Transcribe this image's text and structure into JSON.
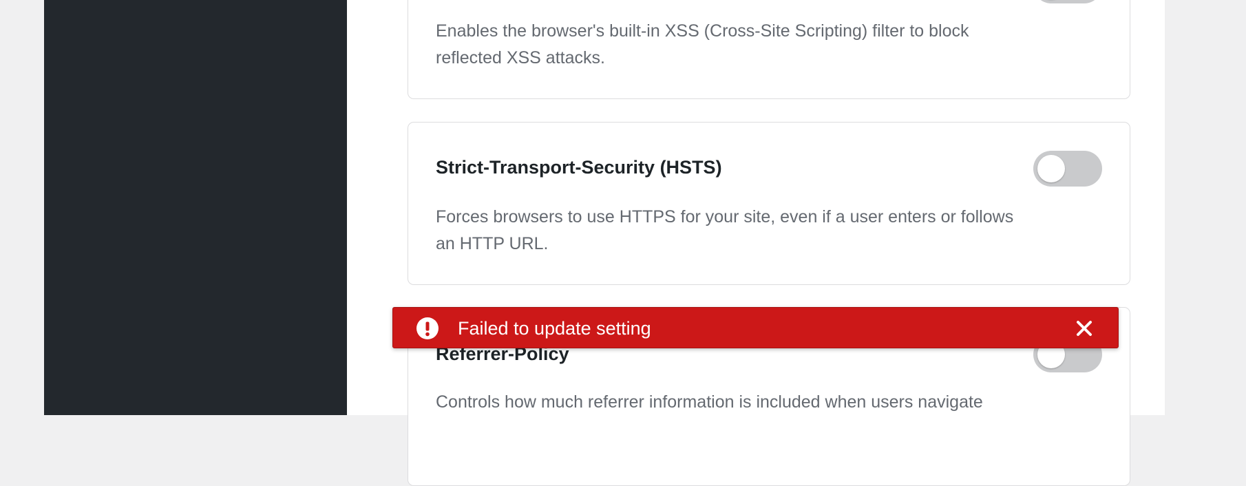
{
  "settings": [
    {
      "title": "",
      "description": "Enables the browser's built-in XSS (Cross-Site Scripting) filter to block reflected XSS attacks.",
      "enabled": false
    },
    {
      "title": "Strict-Transport-Security (HSTS)",
      "description": "Forces browsers to use HTTPS for your site, even if a user enters or follows an HTTP URL.",
      "enabled": false
    },
    {
      "title": "Referrer-Policy",
      "description": "Controls how much referrer information is included when users navigate",
      "enabled": false
    }
  ],
  "notice": {
    "message": "Failed to update setting",
    "type": "error",
    "icon": "exclamation-circle-icon",
    "close_icon": "close-icon"
  },
  "colors": {
    "sidebar": "#23282d",
    "error": "#cc1818",
    "toggle_off": "#c9cacc"
  }
}
